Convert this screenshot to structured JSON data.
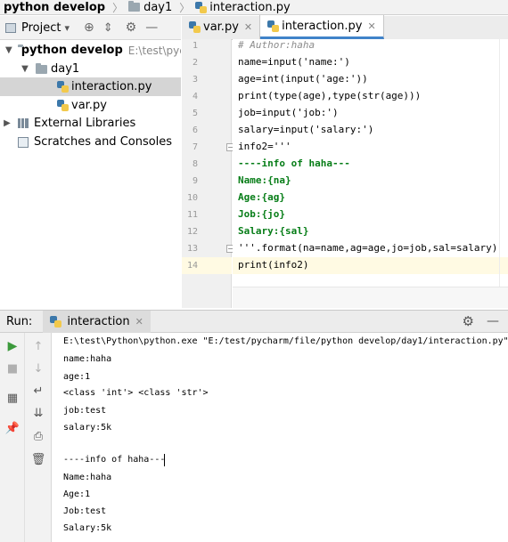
{
  "breadcrumb": {
    "project": "python develop",
    "folder": "day1",
    "file": "interaction.py"
  },
  "project_panel": {
    "title": "Project",
    "dropdown": "▾"
  },
  "tree": {
    "root": {
      "label": "python develop",
      "path": "E:\\test\\pyc"
    },
    "folder": "day1",
    "files": [
      "interaction.py",
      "var.py"
    ],
    "external": "External Libraries",
    "scratches": "Scratches and Consoles"
  },
  "tabs": [
    {
      "label": "var.py"
    },
    {
      "label": "interaction.py"
    }
  ],
  "editor": {
    "line_numbers": [
      "1",
      "2",
      "3",
      "4",
      "5",
      "6",
      "7",
      "8",
      "9",
      "10",
      "11",
      "12",
      "13",
      "14"
    ],
    "lines": [
      "# Author:haha",
      "name=input('name:')",
      "age=int(input('age:'))",
      "print(type(age),type(str(age)))",
      "job=input('job:')",
      "salary=input('salary:')",
      "info2='''",
      "----info of haha---",
      "Name:{na}",
      "Age:{ag}",
      "Job:{jo}",
      "Salary:{sal}",
      "'''.format(na=name,ag=age,jo=job,sal=salary)",
      "print(info2)"
    ],
    "current_line": 14
  },
  "run": {
    "label": "Run:",
    "tab": "interaction",
    "output": [
      "E:\\test\\Python\\python.exe \"E:/test/pycharm/file/python develop/day1/interaction.py\"",
      "name:haha",
      "age:1",
      "<class 'int'> <class 'str'>",
      "job:test",
      "salary:5k",
      "",
      "----info of haha---",
      "Name:haha",
      "Age:1",
      "Job:test",
      "Salary:5k"
    ]
  },
  "colors": {
    "accent": "#4083c9",
    "string_green": "#067d17",
    "keyword_blue": "#0033b3",
    "input_green": "#00a000"
  }
}
